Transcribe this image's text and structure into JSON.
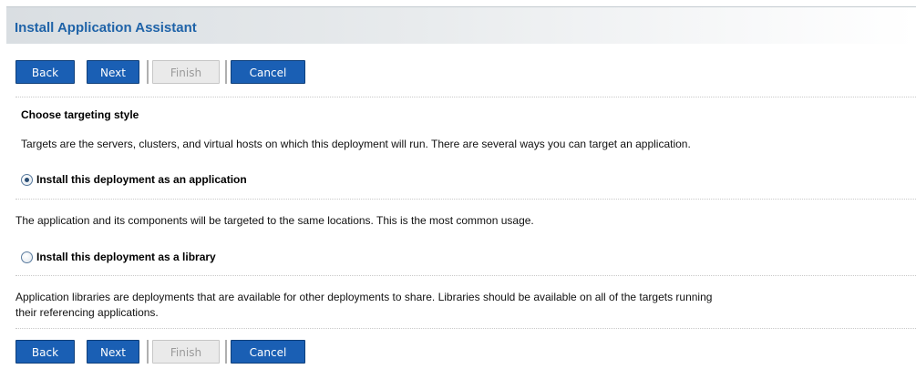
{
  "title": "Install Application Assistant",
  "buttons": {
    "back": "Back",
    "next": "Next",
    "finish": "Finish",
    "cancel": "Cancel"
  },
  "section": {
    "heading": "Choose targeting style",
    "description": "Targets are the servers, clusters, and virtual hosts on which this deployment will run. There are several ways you can target an application."
  },
  "options": [
    {
      "label": "Install this deployment as an application",
      "selected": true,
      "description": "The application and its components will be targeted to the same locations. This is the most common usage."
    },
    {
      "label": "Install this deployment as a library",
      "selected": false,
      "description_line1": "Application libraries are deployments that are available for other deployments to share. Libraries should be available on all of the targets running",
      "description_line2": "their referencing applications."
    }
  ],
  "colors": {
    "title": "#1f63a8",
    "button": "#1a5fb4",
    "button_disabled": "#eaeaea"
  }
}
